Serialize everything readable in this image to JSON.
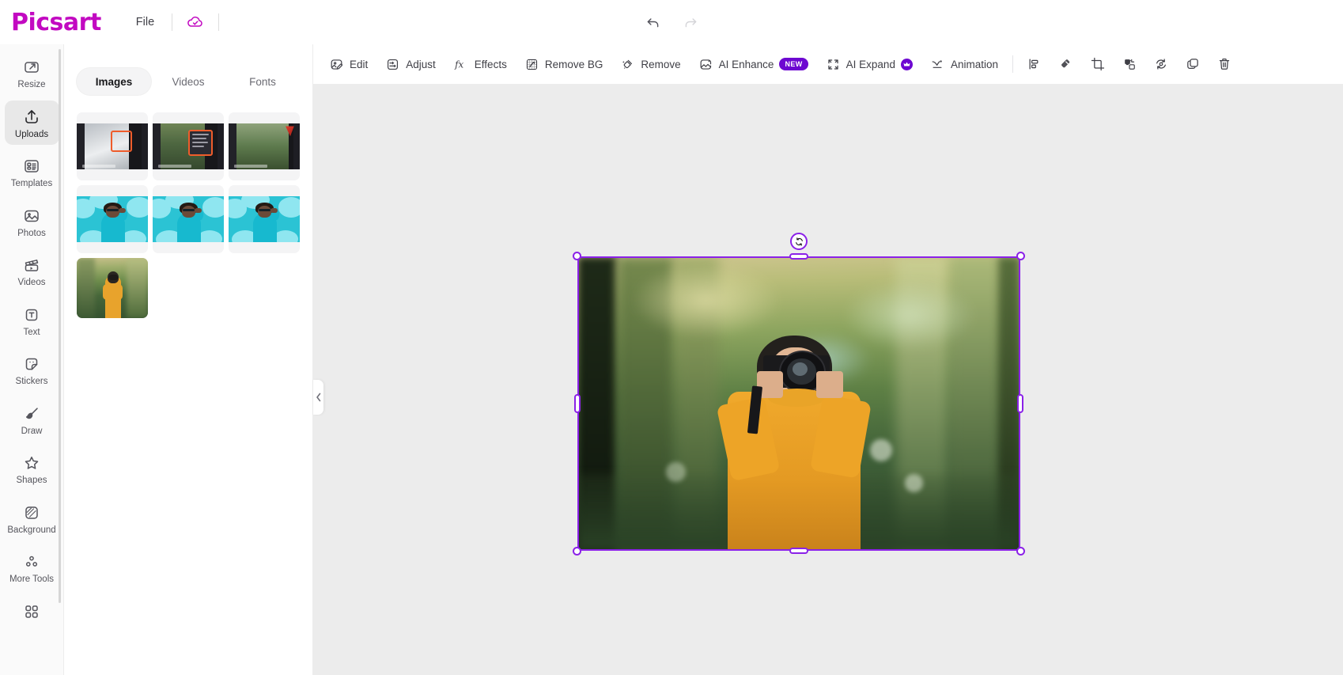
{
  "app": {
    "brand": "Picsart",
    "brand_color": "#C209C1",
    "accent_color": "#8b21e8",
    "badge_color": "#6d07d1"
  },
  "topbar": {
    "file_label": "File",
    "cloud_icon": "cloud-check-icon",
    "undo_icon": "undo-arrow-icon",
    "redo_icon": "redo-arrow-icon"
  },
  "sidebar": {
    "items": [
      {
        "label": "Resize",
        "icon": "resize-icon",
        "active": false
      },
      {
        "label": "Uploads",
        "icon": "upload-icon",
        "active": true
      },
      {
        "label": "Templates",
        "icon": "templates-icon",
        "active": false
      },
      {
        "label": "Photos",
        "icon": "photo-icon",
        "active": false
      },
      {
        "label": "Videos",
        "icon": "video-clapper-icon",
        "active": false
      },
      {
        "label": "Text",
        "icon": "text-box-icon",
        "active": false
      },
      {
        "label": "Stickers",
        "icon": "sticker-icon",
        "active": false
      },
      {
        "label": "Draw",
        "icon": "paintbrush-icon",
        "active": false
      },
      {
        "label": "Shapes",
        "icon": "star-icon",
        "active": false
      },
      {
        "label": "Background",
        "icon": "background-icon",
        "active": false
      },
      {
        "label": "More Tools",
        "icon": "more-tools-icon",
        "active": false
      }
    ],
    "grid_icon": "apps-grid-icon"
  },
  "panel": {
    "tabs": [
      {
        "label": "Images",
        "active": true
      },
      {
        "label": "Videos",
        "active": false
      },
      {
        "label": "Fonts",
        "active": false
      }
    ],
    "thumbnails": [
      {
        "name": "upload-thumb-1",
        "art": "dark-bride"
      },
      {
        "name": "upload-thumb-2",
        "art": "dark-menu"
      },
      {
        "name": "upload-thumb-3",
        "art": "dark-forest"
      },
      {
        "name": "upload-thumb-4",
        "art": "teal-portrait"
      },
      {
        "name": "upload-thumb-5",
        "art": "teal-portrait"
      },
      {
        "name": "upload-thumb-6",
        "art": "teal-portrait"
      },
      {
        "name": "upload-thumb-7",
        "art": "photographer"
      }
    ],
    "collapse_icon": "chevron-left-icon"
  },
  "toolbar": {
    "items": [
      {
        "label": "Edit",
        "icon": "edit-image-icon",
        "badge": null,
        "type": "text"
      },
      {
        "label": "Adjust",
        "icon": "adjust-icon",
        "badge": null,
        "type": "text"
      },
      {
        "label": "Effects",
        "icon": "fx-icon",
        "badge": null,
        "type": "text"
      },
      {
        "label": "Remove BG",
        "icon": "remove-bg-icon",
        "badge": null,
        "type": "text"
      },
      {
        "label": "Remove",
        "icon": "eraser-wand-icon",
        "badge": null,
        "type": "text"
      },
      {
        "label": "AI Enhance",
        "icon": "ai-enhance-icon",
        "badge": "NEW",
        "type": "text"
      },
      {
        "label": "AI Expand",
        "icon": "ai-expand-icon",
        "badge": "crown",
        "type": "text"
      },
      {
        "label": "Animation",
        "icon": "animation-icon",
        "badge": null,
        "type": "text"
      }
    ],
    "icon_buttons": [
      {
        "icon": "align-icon"
      },
      {
        "icon": "eraser-icon"
      },
      {
        "icon": "crop-icon"
      },
      {
        "icon": "layer-order-icon"
      },
      {
        "icon": "flip-rotate-icon"
      },
      {
        "icon": "duplicate-icon"
      },
      {
        "icon": "delete-trash-icon"
      }
    ]
  },
  "canvas": {
    "selection": {
      "rotate_icon": "rotate-handle-icon",
      "handles": [
        "top-left",
        "top-right",
        "bottom-left",
        "bottom-right",
        "top-center",
        "bottom-center",
        "left-center",
        "right-center"
      ]
    },
    "image_name": "photographer-with-camera-image"
  }
}
